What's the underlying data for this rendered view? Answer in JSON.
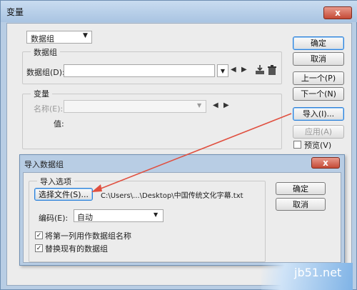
{
  "main_dialog": {
    "title": "变量",
    "close_symbol": "x",
    "type_select_value": "数据组",
    "dataset_group_label": "数据组",
    "dataset_field_label": "数据组(D):",
    "dataset_value": "",
    "variable_group_label": "变量",
    "name_field_label": "名称(E):",
    "name_value": "",
    "value_label": "值:",
    "buttons": {
      "ok": "确定",
      "cancel": "取消",
      "prev": "上一个(P)",
      "next": "下一个(N)",
      "import": "导入(I)...",
      "apply": "应用(A)"
    },
    "preview_label": "预览(V)"
  },
  "import_dialog": {
    "title": "导入数据组",
    "close_symbol": "x",
    "options_group_label": "导入选项",
    "select_file_button": "选择文件(S)...",
    "file_path": "C:\\Users\\...\\Desktop\\中国传统文化字幕.txt",
    "encoding_label": "编码(E):",
    "encoding_value": "自动",
    "checkbox_first_column": "将第一列用作数据组名称",
    "checkbox_replace": "替换现有的数据组",
    "ok_button": "确定",
    "cancel_button": "取消"
  },
  "watermark_text": "jb51.net",
  "colors": {
    "arrow": "#e05040",
    "titlebar": "#b8cde4",
    "close_button": "#c44a36"
  },
  "icons": [
    "dropdown-arrow-icon",
    "prev-arrow-icon",
    "next-arrow-icon",
    "import-data-icon",
    "delete-trash-icon",
    "checkmark-icon"
  ]
}
